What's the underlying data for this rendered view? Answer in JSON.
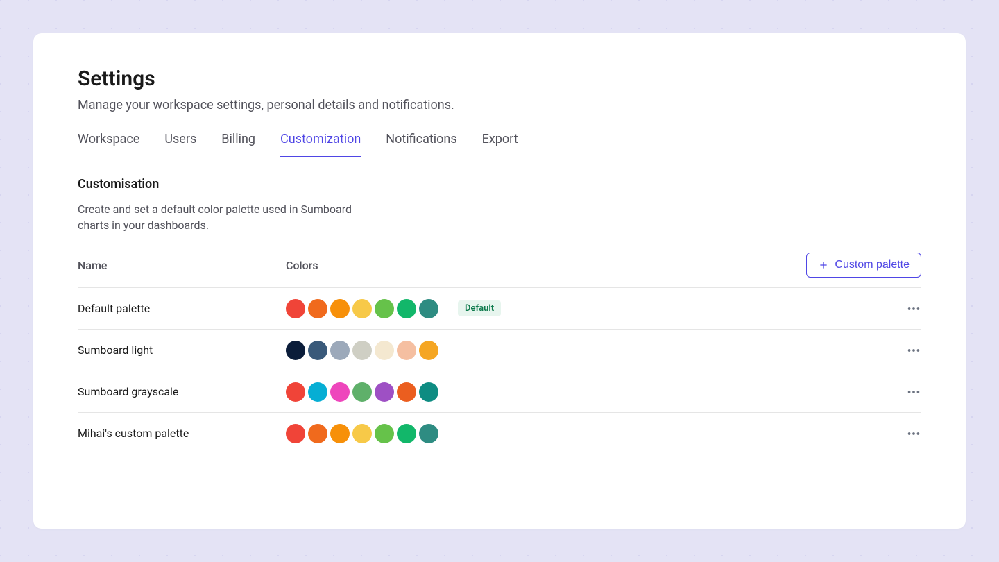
{
  "header": {
    "title": "Settings",
    "subtitle": "Manage your workspace settings, personal details and notifications."
  },
  "tabs": [
    {
      "label": "Workspace",
      "active": false
    },
    {
      "label": "Users",
      "active": false
    },
    {
      "label": "Billing",
      "active": false
    },
    {
      "label": "Customization",
      "active": true
    },
    {
      "label": "Notifications",
      "active": false
    },
    {
      "label": "Export",
      "active": false
    }
  ],
  "section": {
    "title": "Customisation",
    "description": "Create and set a default color palette used in Sumboard charts in your dashboards."
  },
  "table": {
    "columns": {
      "name": "Name",
      "colors": "Colors"
    },
    "add_button": "Custom palette",
    "badge_default": "Default"
  },
  "palettes": [
    {
      "name": "Default palette",
      "is_default": true,
      "colors": [
        "#F04438",
        "#F06A1D",
        "#F79009",
        "#F7C948",
        "#66C24A",
        "#12B76A",
        "#2E8C82"
      ]
    },
    {
      "name": "Sumboard light",
      "is_default": false,
      "colors": [
        "#0B1D3A",
        "#3A5A7A",
        "#9CA9BA",
        "#CFCFC4",
        "#F4E8D0",
        "#F5BFA1",
        "#F5A623"
      ]
    },
    {
      "name": "Sumboard grayscale",
      "is_default": false,
      "colors": [
        "#F04438",
        "#06AED4",
        "#EE46BC",
        "#5FB06A",
        "#9E50C4",
        "#EB5E1F",
        "#0E8C82"
      ]
    },
    {
      "name": "Mihai's custom palette",
      "is_default": false,
      "colors": [
        "#F04438",
        "#F06A1D",
        "#F79009",
        "#F7C948",
        "#66C24A",
        "#12B76A",
        "#2E8C82"
      ]
    }
  ]
}
